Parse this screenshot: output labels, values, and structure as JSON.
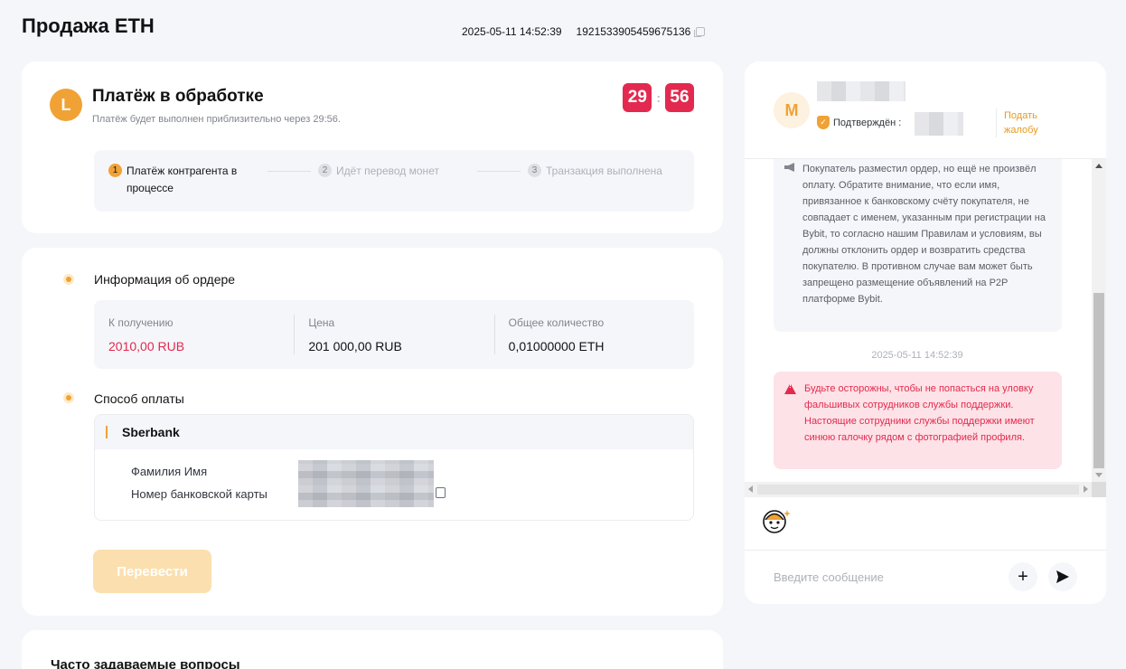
{
  "header": {
    "title": "Продажа ETH",
    "datetime": "2025-05-11 14:52:39",
    "order_id": "1921533905459675136"
  },
  "status": {
    "avatar_letter": "L",
    "title": "Платёж в обработке",
    "subtitle": "Платёж будет выполнен приблизительно через 29:56.",
    "timer_minutes": "29",
    "timer_separator": ":",
    "timer_seconds": "56",
    "steps": [
      {
        "num": "1",
        "label": "Платёж контрагента в процессе"
      },
      {
        "num": "2",
        "label": "Идёт перевод монет"
      },
      {
        "num": "3",
        "label": "Транзакция выполнена"
      }
    ]
  },
  "order_info": {
    "title": "Информация об ордере",
    "receive_label": "К получению",
    "receive_value": "2010,00 RUB",
    "price_label": "Цена",
    "price_value": "201 000,00 RUB",
    "total_label": "Общее количество",
    "total_value": "0,01000000 ETH"
  },
  "payment": {
    "title": "Способ оплаты",
    "bank": "Sberbank",
    "name_label": "Фамилия Имя",
    "card_label": "Номер банковской карты"
  },
  "transfer_button": "Перевести",
  "faq_title": "Часто задаваемые вопросы",
  "chat": {
    "avatar_letter": "M",
    "verified_label": "Подтверждён :",
    "complain_label": "Подать жалобу",
    "system_message": "Покупатель разместил ордер, но ещё не произвёл оплату. Обратите внимание, что если имя, привязанное к банковскому счёту покупателя, не совпадает с именем, указанным при регистрации на Bybit, то согласно нашим Правилам и условиям, вы должны отклонить ордер и возвратить средства покупателю. В противном случае вам может быть запрещено размещение объявлений на P2P платформе Bybit.",
    "time": "2025-05-11 14:52:39",
    "warning_message": "Будьте осторожны, чтобы не попасться на уловку фальшивых сотрудников службы поддержки. Настоящие сотрудники службы поддержки имеют синюю галочку рядом с фотографией профиля.",
    "input_placeholder": "Введите сообщение",
    "add_glyph": "+"
  },
  "colors": {
    "accent": "#f0a235",
    "danger": "#e3294f",
    "background": "#f5f6fa"
  }
}
